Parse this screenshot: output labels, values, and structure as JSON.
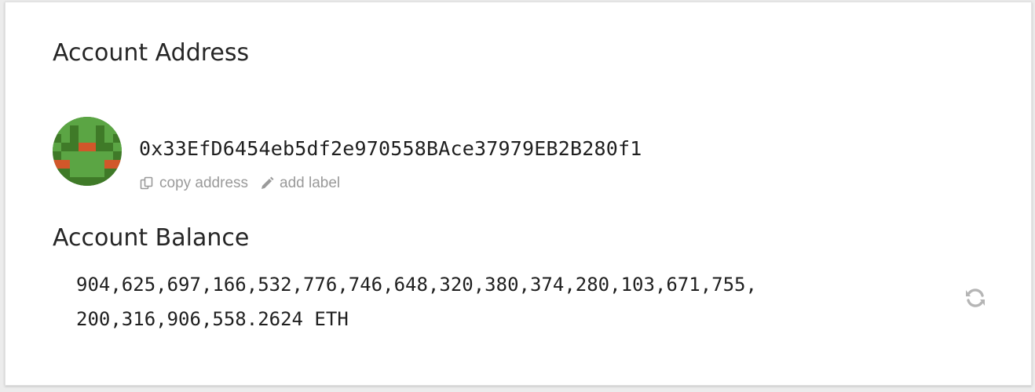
{
  "account_address": {
    "heading": "Account Address",
    "address": "0x33EfD6454eb5df2e970558BAce37979EB2B280f1",
    "actions": {
      "copy_label": "copy address",
      "add_label": "add label"
    }
  },
  "account_balance": {
    "heading": "Account Balance",
    "line1": "904,625,697,166,532,776,746,648,320,380,374,280,103,671,755,",
    "line2": "200,316,906,558.2624 ETH"
  },
  "icons": {
    "avatar": "identicon-avatar",
    "copy": "copy-icon",
    "pencil": "pencil-icon",
    "refresh": "refresh-icon"
  },
  "colors": {
    "identicon_dark": "#3f7a28",
    "identicon_light": "#5ba544",
    "identicon_accent": "#d2572a",
    "muted_text": "#9a9a9a"
  }
}
